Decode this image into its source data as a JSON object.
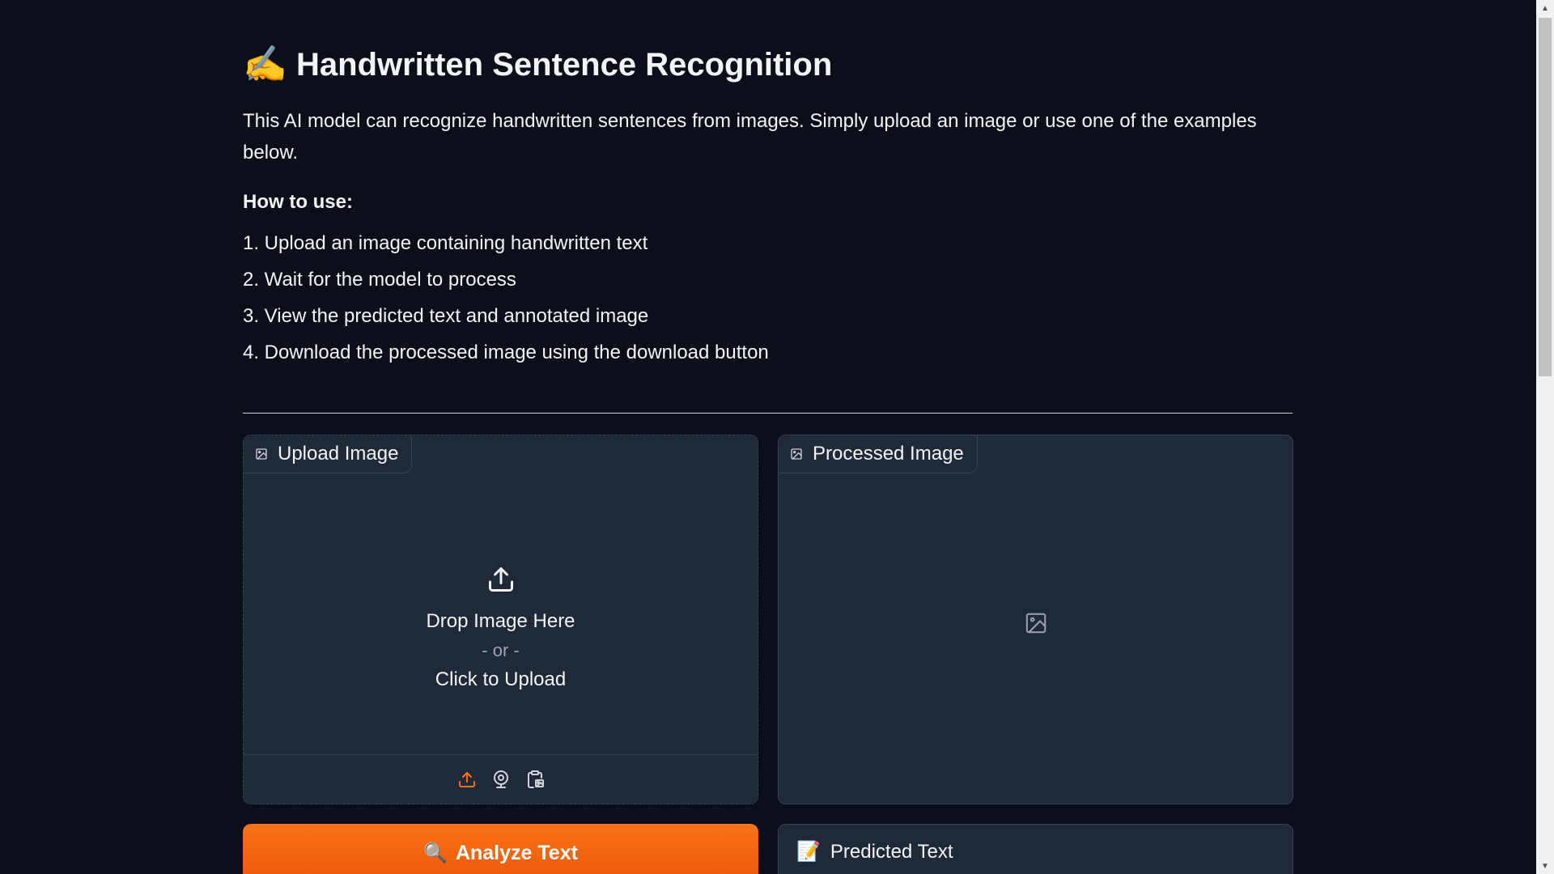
{
  "header": {
    "emoji": "✍️",
    "title": "Handwritten Sentence Recognition"
  },
  "intro": "This AI model can recognize handwritten sentences from images. Simply upload an image or use one of the examples below.",
  "how_to": {
    "title": "How to use:",
    "steps": [
      "1. Upload an image containing handwritten text",
      "2. Wait for the model to process",
      "3. View the predicted text and annotated image",
      "4. Download the processed image using the download button"
    ]
  },
  "upload_panel": {
    "label": "Upload Image",
    "drop_text": "Drop Image Here",
    "or_text": "- or -",
    "click_text": "Click to Upload",
    "sources": [
      "upload-icon",
      "webcam-icon",
      "clipboard-icon"
    ]
  },
  "processed_panel": {
    "label": "Processed Image"
  },
  "analyze_button": {
    "emoji": "🔍",
    "label": "Analyze Text"
  },
  "predicted_panel": {
    "emoji": "📝",
    "label": "Predicted Text"
  },
  "colors": {
    "background": "#0b0f19",
    "panel": "#1f2937",
    "border": "#374151",
    "accent": "#f97316",
    "text": "#f3f4f6",
    "muted": "#9ca3af"
  }
}
